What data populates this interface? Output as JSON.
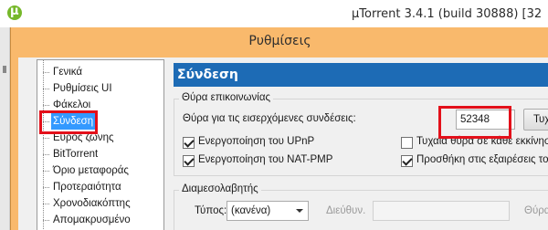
{
  "app": {
    "title": "µTorrent 3.4.1  (build 30888) [32"
  },
  "dialog": {
    "title": "Ρυθμίσεις"
  },
  "tree": {
    "items": [
      {
        "label": "Γενικά"
      },
      {
        "label": "Ρυθμίσεις UI"
      },
      {
        "label": "Φάκελοι"
      },
      {
        "label": "Σύνδεση",
        "selected": true
      },
      {
        "label": "Εύρος ζώνης"
      },
      {
        "label": "BitTorrent"
      },
      {
        "label": "Όριο μεταφοράς"
      },
      {
        "label": "Προτεραιότητα"
      },
      {
        "label": "Χρονοδιακόπτης"
      },
      {
        "label": "Απομακρυσμένο"
      }
    ]
  },
  "section": {
    "header": "Σύνδεση",
    "listening_port": {
      "legend": "Θύρα επικοινωνίας",
      "port_label": "Θύρα για τις εισερχόμενες συνδέσεις:",
      "port_value": "52348",
      "random_button": "Τυχαία",
      "upnp_label": "Ενεργοποίηση του UPnP",
      "upnp_checked": true,
      "natpmp_label": "Ενεργοποίηση του NAT-PMP",
      "natpmp_checked": true,
      "random_each_start_label": "Τυχαία θύρα σε κάθε εκκίνηση",
      "random_each_start_checked": false,
      "firewall_exception_label": "Προσθήκη στις εξαιρέσεις του",
      "firewall_exception_checked": true
    },
    "proxy": {
      "legend": "Διαμεσολαβητής",
      "type_label": "Τύπος:",
      "type_value": "(κανένα)",
      "address_label": "Διεύθυν.",
      "port_label": "Θύρα:"
    }
  },
  "colors": {
    "dialog_frame": "#f9b96c",
    "section_header": "#1d6bb5",
    "highlight": "#e3101a",
    "selection": "#3399ff"
  }
}
